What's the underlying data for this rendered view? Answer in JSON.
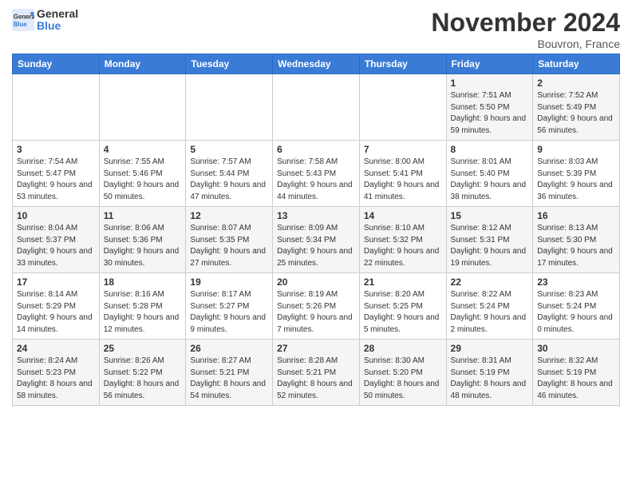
{
  "logo": {
    "line1": "General",
    "line2": "Blue"
  },
  "title": "November 2024",
  "location": "Bouvron, France",
  "days_of_week": [
    "Sunday",
    "Monday",
    "Tuesday",
    "Wednesday",
    "Thursday",
    "Friday",
    "Saturday"
  ],
  "weeks": [
    [
      {
        "day": "",
        "info": ""
      },
      {
        "day": "",
        "info": ""
      },
      {
        "day": "",
        "info": ""
      },
      {
        "day": "",
        "info": ""
      },
      {
        "day": "",
        "info": ""
      },
      {
        "day": "1",
        "info": "Sunrise: 7:51 AM\nSunset: 5:50 PM\nDaylight: 9 hours and 59 minutes."
      },
      {
        "day": "2",
        "info": "Sunrise: 7:52 AM\nSunset: 5:49 PM\nDaylight: 9 hours and 56 minutes."
      }
    ],
    [
      {
        "day": "3",
        "info": "Sunrise: 7:54 AM\nSunset: 5:47 PM\nDaylight: 9 hours and 53 minutes."
      },
      {
        "day": "4",
        "info": "Sunrise: 7:55 AM\nSunset: 5:46 PM\nDaylight: 9 hours and 50 minutes."
      },
      {
        "day": "5",
        "info": "Sunrise: 7:57 AM\nSunset: 5:44 PM\nDaylight: 9 hours and 47 minutes."
      },
      {
        "day": "6",
        "info": "Sunrise: 7:58 AM\nSunset: 5:43 PM\nDaylight: 9 hours and 44 minutes."
      },
      {
        "day": "7",
        "info": "Sunrise: 8:00 AM\nSunset: 5:41 PM\nDaylight: 9 hours and 41 minutes."
      },
      {
        "day": "8",
        "info": "Sunrise: 8:01 AM\nSunset: 5:40 PM\nDaylight: 9 hours and 38 minutes."
      },
      {
        "day": "9",
        "info": "Sunrise: 8:03 AM\nSunset: 5:39 PM\nDaylight: 9 hours and 36 minutes."
      }
    ],
    [
      {
        "day": "10",
        "info": "Sunrise: 8:04 AM\nSunset: 5:37 PM\nDaylight: 9 hours and 33 minutes."
      },
      {
        "day": "11",
        "info": "Sunrise: 8:06 AM\nSunset: 5:36 PM\nDaylight: 9 hours and 30 minutes."
      },
      {
        "day": "12",
        "info": "Sunrise: 8:07 AM\nSunset: 5:35 PM\nDaylight: 9 hours and 27 minutes."
      },
      {
        "day": "13",
        "info": "Sunrise: 8:09 AM\nSunset: 5:34 PM\nDaylight: 9 hours and 25 minutes."
      },
      {
        "day": "14",
        "info": "Sunrise: 8:10 AM\nSunset: 5:32 PM\nDaylight: 9 hours and 22 minutes."
      },
      {
        "day": "15",
        "info": "Sunrise: 8:12 AM\nSunset: 5:31 PM\nDaylight: 9 hours and 19 minutes."
      },
      {
        "day": "16",
        "info": "Sunrise: 8:13 AM\nSunset: 5:30 PM\nDaylight: 9 hours and 17 minutes."
      }
    ],
    [
      {
        "day": "17",
        "info": "Sunrise: 8:14 AM\nSunset: 5:29 PM\nDaylight: 9 hours and 14 minutes."
      },
      {
        "day": "18",
        "info": "Sunrise: 8:16 AM\nSunset: 5:28 PM\nDaylight: 9 hours and 12 minutes."
      },
      {
        "day": "19",
        "info": "Sunrise: 8:17 AM\nSunset: 5:27 PM\nDaylight: 9 hours and 9 minutes."
      },
      {
        "day": "20",
        "info": "Sunrise: 8:19 AM\nSunset: 5:26 PM\nDaylight: 9 hours and 7 minutes."
      },
      {
        "day": "21",
        "info": "Sunrise: 8:20 AM\nSunset: 5:25 PM\nDaylight: 9 hours and 5 minutes."
      },
      {
        "day": "22",
        "info": "Sunrise: 8:22 AM\nSunset: 5:24 PM\nDaylight: 9 hours and 2 minutes."
      },
      {
        "day": "23",
        "info": "Sunrise: 8:23 AM\nSunset: 5:24 PM\nDaylight: 9 hours and 0 minutes."
      }
    ],
    [
      {
        "day": "24",
        "info": "Sunrise: 8:24 AM\nSunset: 5:23 PM\nDaylight: 8 hours and 58 minutes."
      },
      {
        "day": "25",
        "info": "Sunrise: 8:26 AM\nSunset: 5:22 PM\nDaylight: 8 hours and 56 minutes."
      },
      {
        "day": "26",
        "info": "Sunrise: 8:27 AM\nSunset: 5:21 PM\nDaylight: 8 hours and 54 minutes."
      },
      {
        "day": "27",
        "info": "Sunrise: 8:28 AM\nSunset: 5:21 PM\nDaylight: 8 hours and 52 minutes."
      },
      {
        "day": "28",
        "info": "Sunrise: 8:30 AM\nSunset: 5:20 PM\nDaylight: 8 hours and 50 minutes."
      },
      {
        "day": "29",
        "info": "Sunrise: 8:31 AM\nSunset: 5:19 PM\nDaylight: 8 hours and 48 minutes."
      },
      {
        "day": "30",
        "info": "Sunrise: 8:32 AM\nSunset: 5:19 PM\nDaylight: 8 hours and 46 minutes."
      }
    ]
  ]
}
